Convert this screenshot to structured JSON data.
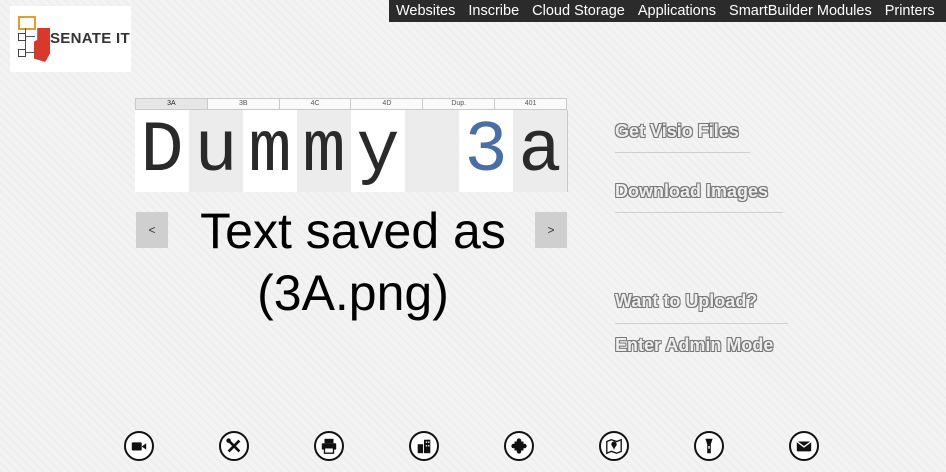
{
  "nav": {
    "items": [
      "Websites",
      "Inscribe",
      "Cloud Storage",
      "Applications",
      "SmartBuilder Modules",
      "Printers"
    ]
  },
  "logo": {
    "brand": "SENATE IT"
  },
  "tabs": [
    "3A",
    "3B",
    "4C",
    "4D",
    "Dup.",
    "401"
  ],
  "display": {
    "chars": [
      "D",
      "u",
      "m",
      "m",
      "y",
      "",
      "3",
      "a"
    ]
  },
  "arrows": {
    "prev": "<",
    "next": ">"
  },
  "status": {
    "line1": "Text saved as",
    "line2": "(3A.png)"
  },
  "links": {
    "visio": "Get Visio Files",
    "images": "Download Images",
    "upload": "Want to Upload?",
    "admin": "Enter Admin Mode"
  },
  "bottom_icons": [
    "video-icon",
    "tools-icon",
    "printer-icon",
    "buildings-icon",
    "puzzle-icon",
    "map-pin-icon",
    "flashlight-icon",
    "mail-icon"
  ]
}
